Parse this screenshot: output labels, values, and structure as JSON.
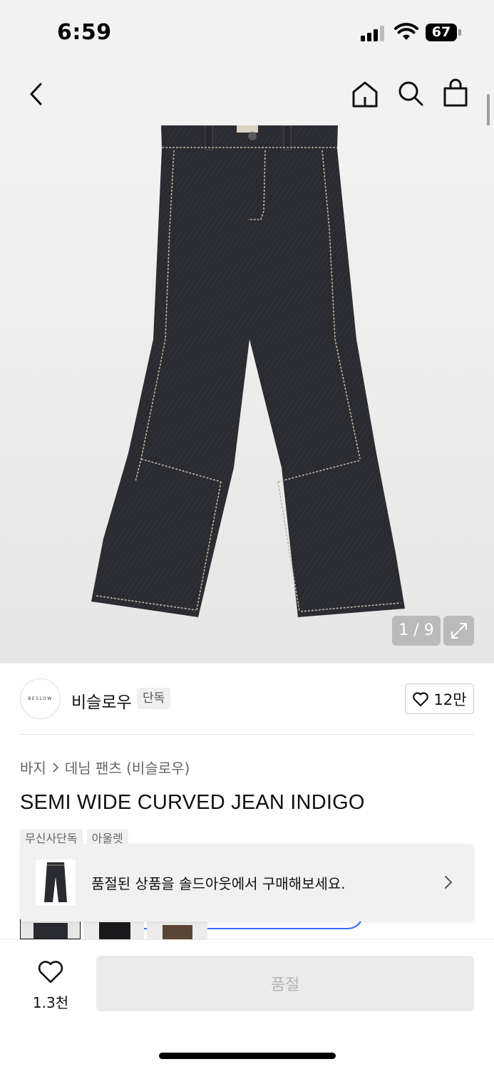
{
  "status_bar": {
    "time": "6:59",
    "battery": "67",
    "icons": [
      "cellular-signal-icon",
      "wifi-icon",
      "battery-icon"
    ]
  },
  "topnav": {
    "icons": [
      "chevron-left-icon",
      "home-icon",
      "search-icon",
      "shopping-bag-icon"
    ]
  },
  "hero": {
    "page_indicator": "1 / 9",
    "expand_icon": "expand-icon"
  },
  "brand": {
    "logo_text": "BESLOW",
    "name": "비슬로우",
    "badge": "단독",
    "like_count": "12만"
  },
  "product": {
    "breadcrumb": [
      "바지",
      "데님 팬츠 (비슬로우)"
    ],
    "title": "SEMI WIDE CURVED JEAN INDIGO",
    "tags": [
      "무신사단독",
      "아울렛"
    ]
  },
  "soldout_banner": {
    "text": "품절된 상품을 솔드아웃에서 구매해보세요."
  },
  "bottom_bar": {
    "like_count": "1.3천",
    "buy_label": "품절"
  },
  "colors": {
    "accent_blue": "#2f6bff",
    "denim": "#2a2b30",
    "stitch": "#bdb7a8",
    "disabled_button": "#ebebeb"
  }
}
